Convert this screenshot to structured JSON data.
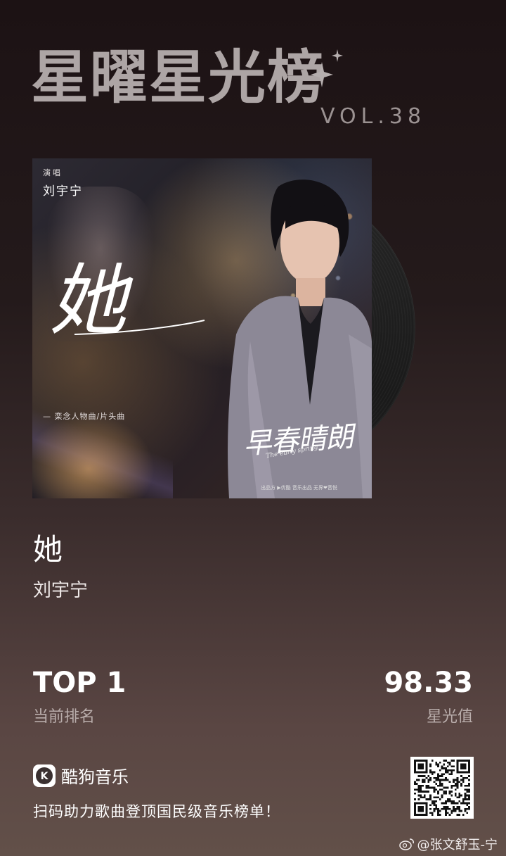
{
  "header": {
    "title": "星曜星光榜",
    "volume": "VOL.38"
  },
  "cover": {
    "vocal_label": "演唱",
    "singer": "刘宇宁",
    "song_char": "她",
    "subtitle": "— 栾念人物曲/片头曲",
    "drama_title": "早春晴朗",
    "drama_english": "The early spring",
    "credits": "出品方 ▶优酷  音乐出品  无界❤音悦"
  },
  "song": {
    "title": "她",
    "artist": "刘宇宁"
  },
  "stats": {
    "rank_value": "TOP 1",
    "rank_label": "当前排名",
    "score_value": "98.33",
    "score_label": "星光值"
  },
  "brand": {
    "logo_letter": "K",
    "name": "酷狗音乐"
  },
  "cta": "扫码助力歌曲登顶国民级音乐榜单！",
  "watermark": "@张文舒玉-宁"
}
